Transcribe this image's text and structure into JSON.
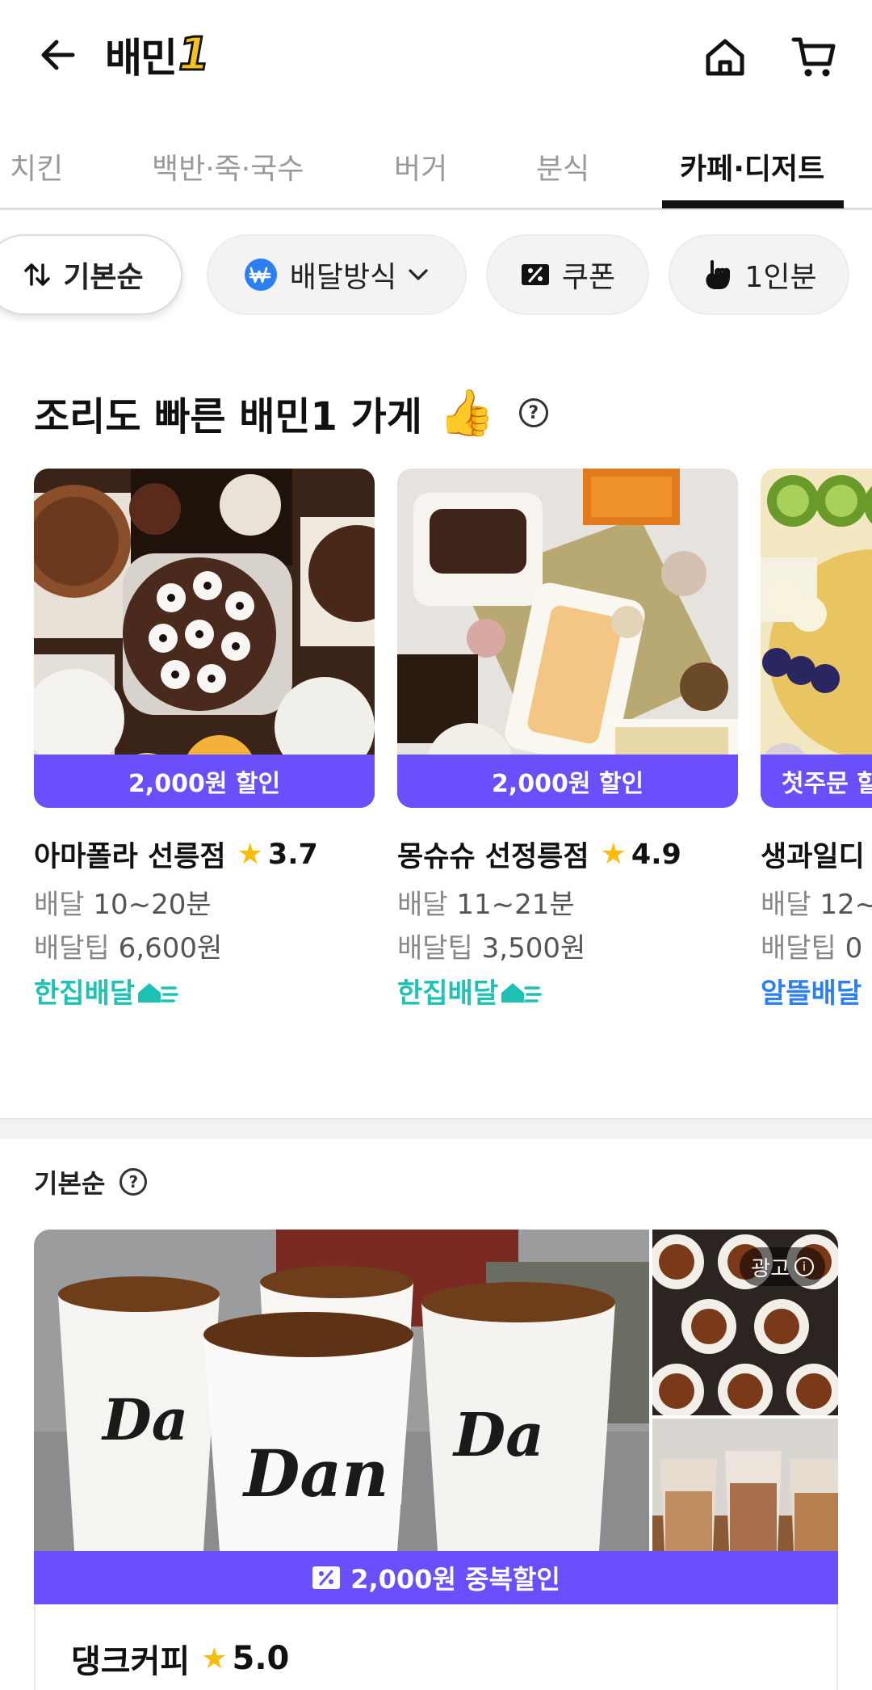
{
  "header": {
    "logo_text": "배민",
    "logo_number": "1",
    "icons": {
      "back": "back-arrow-icon",
      "home": "home-icon",
      "cart": "cart-icon"
    }
  },
  "tabs": [
    {
      "label": "치킨",
      "active": false
    },
    {
      "label": "백반·죽·국수",
      "active": false
    },
    {
      "label": "버거",
      "active": false
    },
    {
      "label": "분식",
      "active": false
    },
    {
      "label": "카페·디저트",
      "active": true
    }
  ],
  "filters": {
    "sort": "기본순",
    "delivery": "배달방식",
    "coupon": "쿠폰",
    "single": "1인분"
  },
  "fast_section": {
    "title": "조리도 빠른 배민1 가게",
    "help": "?",
    "stores": [
      {
        "banner": "2,000원 할인",
        "name": "아마폴라 선릉점",
        "rating": "3.7",
        "delivery_label": "배달",
        "delivery_time": "10~20분",
        "tip_label": "배달팁",
        "tip": "6,600원",
        "tag": "한집배달"
      },
      {
        "banner": "2,000원 할인",
        "name": "몽슈슈 선정릉점",
        "rating": "4.9",
        "delivery_label": "배달",
        "delivery_time": "11~21분",
        "tip_label": "배달팁",
        "tip": "3,500원",
        "tag": "한집배달"
      },
      {
        "banner": "첫주문 할",
        "name": "생과일디",
        "delivery_label": "배달",
        "delivery_time": "12~",
        "tip_label": "배달팁",
        "tip": "0",
        "tag": "알뜰배달"
      }
    ]
  },
  "basic_section": {
    "title": "기본순",
    "help": "?",
    "featured": {
      "ad_label": "광고",
      "banner": "2,000원 중복할인",
      "name": "댕크커피",
      "rating": "5.0"
    }
  },
  "colors": {
    "accent_purple": "#6b4efc",
    "hanjip_teal": "#1ec2b4",
    "altteul_blue": "#2b7ff0",
    "star_yellow": "#fbbd08"
  }
}
